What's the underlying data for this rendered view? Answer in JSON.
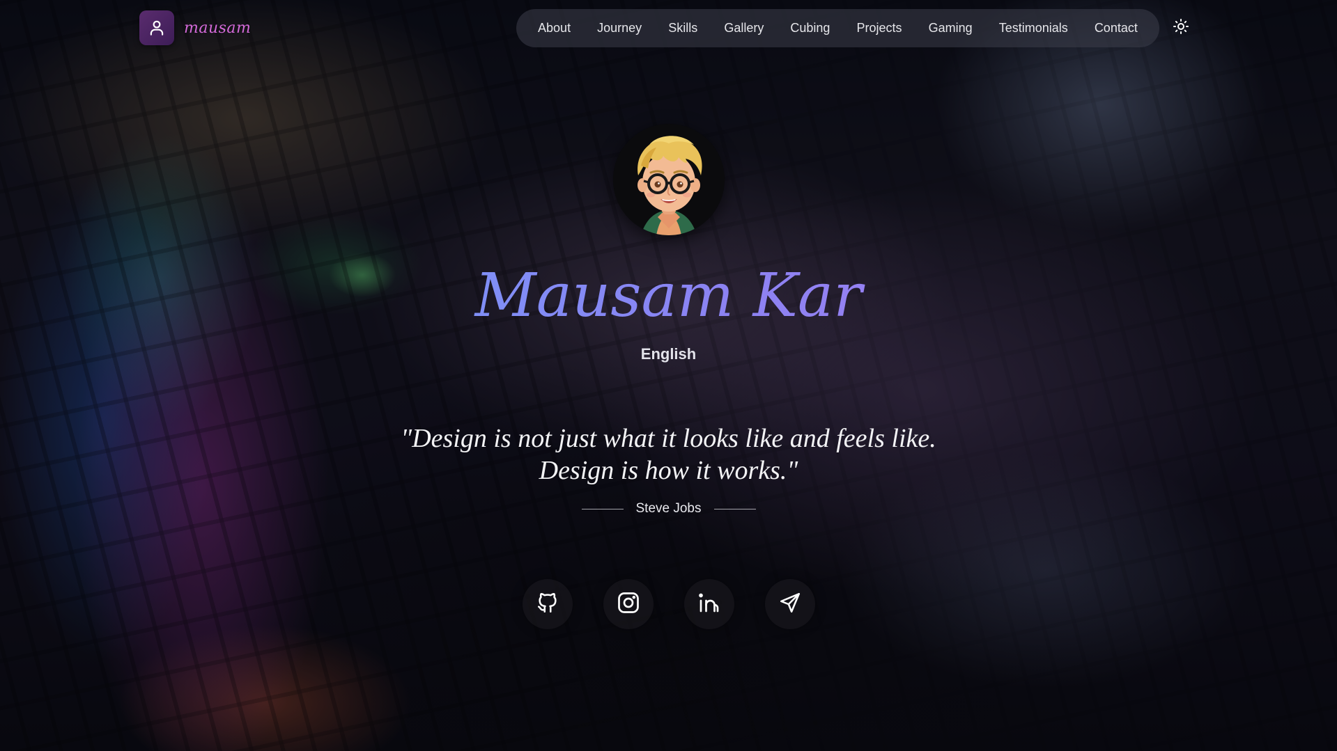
{
  "brand": {
    "name": "mausam",
    "icon": "user-icon"
  },
  "nav": {
    "items": [
      {
        "label": "About"
      },
      {
        "label": "Journey"
      },
      {
        "label": "Skills"
      },
      {
        "label": "Gallery"
      },
      {
        "label": "Cubing"
      },
      {
        "label": "Projects"
      },
      {
        "label": "Gaming"
      },
      {
        "label": "Testimonials"
      },
      {
        "label": "Contact"
      }
    ],
    "theme_toggle_icon": "sun-icon"
  },
  "hero": {
    "avatar_icon": "cartoon-avatar",
    "name": "Mausam Kar",
    "language": "English",
    "quote": "\"Design is not just what it looks like and feels like. Design is how it works.\"",
    "quote_author": "Steve Jobs"
  },
  "social": [
    {
      "icon": "github-icon"
    },
    {
      "icon": "instagram-icon"
    },
    {
      "icon": "linkedin-icon"
    },
    {
      "icon": "send-icon"
    }
  ],
  "colors": {
    "brand_accent": "#d46ad9",
    "name_gradient_start": "#6aa6ff",
    "name_gradient_end": "#b27ef0",
    "nav_text": "#e6e6ea"
  }
}
